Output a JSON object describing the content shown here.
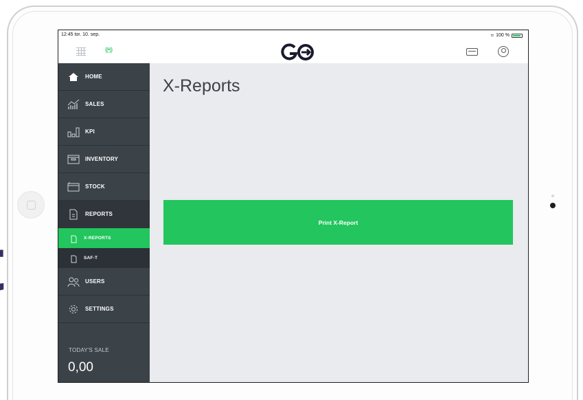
{
  "status_bar": {
    "time_date": "12:45  tor. 10. sep.",
    "battery": "100 %"
  },
  "header": {
    "logo_text": "GO"
  },
  "sidebar": {
    "items": [
      {
        "label": "HOME",
        "icon": "home-icon"
      },
      {
        "label": "SALES",
        "icon": "sales-chart-icon"
      },
      {
        "label": "KPI",
        "icon": "kpi-bars-icon"
      },
      {
        "label": "INVENTORY",
        "icon": "inventory-box-icon"
      },
      {
        "label": "STOCK",
        "icon": "stock-box-icon"
      },
      {
        "label": "REPORTS",
        "icon": "report-document-icon"
      }
    ],
    "sub_items": [
      {
        "label": "X-REPORTS",
        "icon": "document-icon",
        "active": true
      },
      {
        "label": "SAF-T",
        "icon": "document-icon",
        "active": false
      }
    ],
    "items_bottom": [
      {
        "label": "USERS",
        "icon": "users-icon"
      },
      {
        "label": "SETTINGS",
        "icon": "gear-icon"
      }
    ],
    "todays_sale_label": "TODAY'S SALE",
    "todays_sale_value": "0,00"
  },
  "main": {
    "title": "X-Reports",
    "print_button_label": "Print X-Report"
  },
  "colors": {
    "accent": "#22c55e",
    "sidebar": "#3b4248",
    "content_bg": "#e9ebee"
  }
}
